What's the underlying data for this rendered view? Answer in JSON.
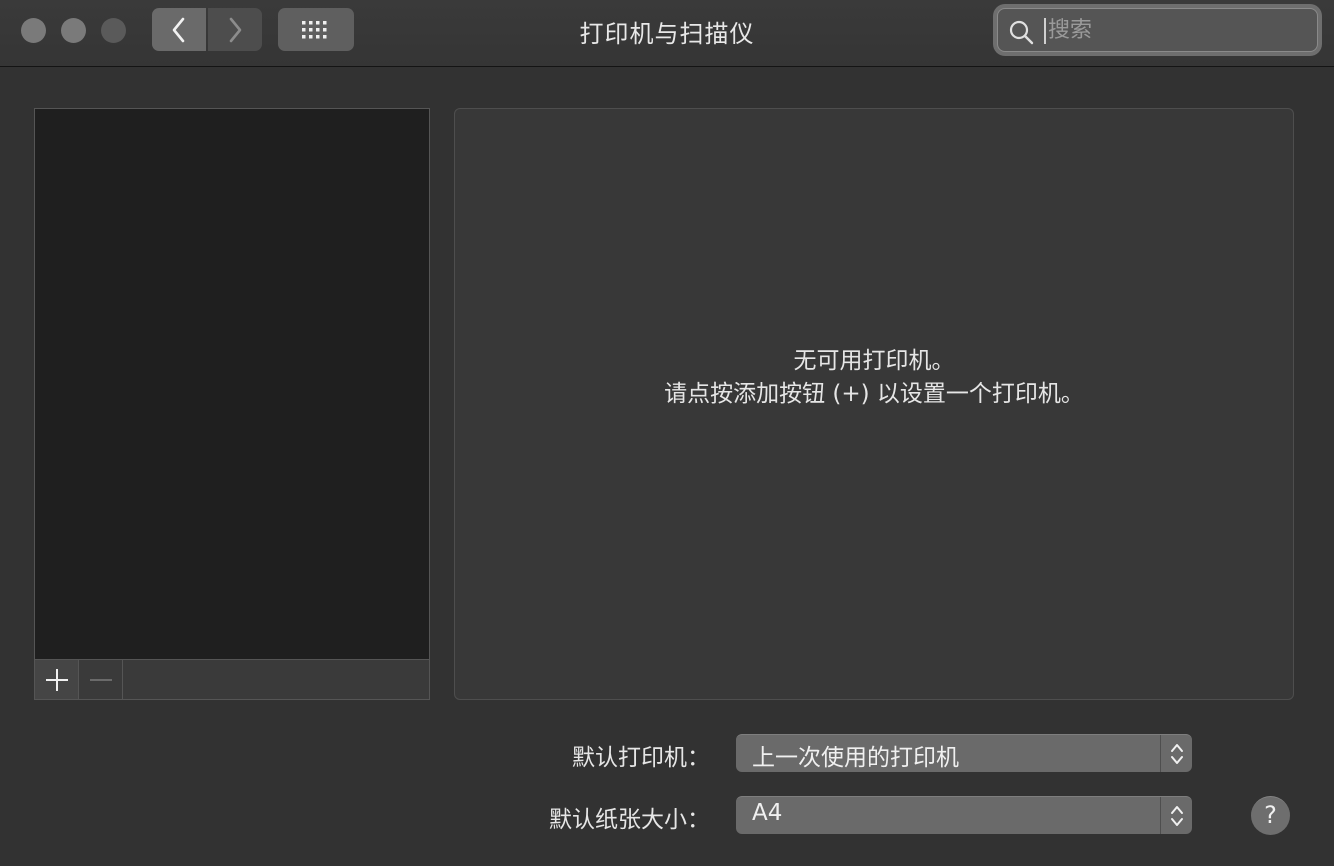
{
  "window": {
    "title": "打印机与扫描仪"
  },
  "toolbar": {
    "back_icon": "chevron-left-icon",
    "forward_icon": "chevron-right-icon",
    "grid_icon": "grid-icon"
  },
  "search": {
    "placeholder": "搜索",
    "value": ""
  },
  "printer_list": {
    "items": [],
    "add_label": "+",
    "remove_label": "−"
  },
  "detail": {
    "empty_line1": "无可用打印机。",
    "empty_line2": "请点按添加按钮 (+) 以设置一个打印机。"
  },
  "settings": {
    "default_printer_label": "默认打印机：",
    "default_printer_value": "上一次使用的打印机",
    "default_paper_label": "默认纸张大小：",
    "default_paper_value": "A4"
  },
  "help": {
    "label": "?"
  }
}
